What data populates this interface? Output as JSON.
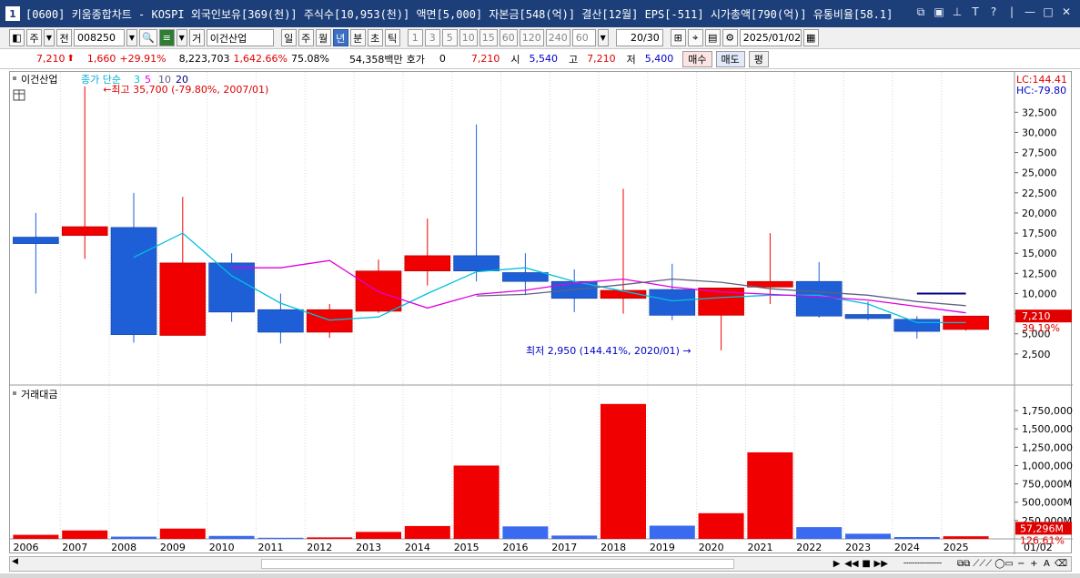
{
  "window": {
    "number": "1",
    "title": "[0600] 키움종합차트 - KOSPI 외국인보유[369(천)] 주식수[10,953(천)] 액면[5,000] 자본금[548(억)] 결산[12월] EPS[-511] 시가총액[790(억)] 유통비율[58.1]"
  },
  "toolbar": {
    "market": "주",
    "jeon": "전",
    "code": "008250",
    "gye": "거",
    "stock_name": "이건산업",
    "periods": [
      "일",
      "주",
      "월",
      "년",
      "분",
      "초",
      "틱"
    ],
    "intervals": [
      "1",
      "3",
      "5",
      "10",
      "15",
      "60",
      "120",
      "240"
    ],
    "interval_value": "60",
    "count": "20/30",
    "date": "2025/01/02"
  },
  "quote": {
    "price": "7,210",
    "change": "1,660",
    "change_pct": "+29.91%",
    "volume": "8,223,703",
    "volume_pct": "1,642.66%",
    "turnover_pct": "75.08%",
    "amount": "54,358백만",
    "hoga_label": "호가",
    "hoga_value": "0",
    "hoga_price": "7,210",
    "open_label": "시",
    "open": "5,540",
    "high_label": "고",
    "high": "7,210",
    "low_label": "저",
    "low": "5,400",
    "buy_label": "매수",
    "sell_label": "매도",
    "avg_label": "평"
  },
  "chart_data": {
    "type": "candlestick",
    "price_panel": {
      "name": "이건산업",
      "ma_legend_prefix": "종가 단순",
      "ma_periods": [
        "3",
        "5",
        "10",
        "20"
      ],
      "ma_colors": [
        "#00c0e0",
        "#e000e0",
        "#606080",
        "#000080"
      ],
      "lc_label": "LC:144.41",
      "hc_label": "HC:-79.80",
      "high_annotation": "최고 35,700 (-79.80%, 2007/01)",
      "low_annotation": "최저 2,950 (144.41%, 2020/01)",
      "current_price_label": "7,210",
      "current_pct_label": "39.19%",
      "y_ticks": [
        "2,500",
        "5,000",
        "7,500",
        "10,000",
        "12,500",
        "15,000",
        "17,500",
        "20,000",
        "22,500",
        "25,000",
        "27,500",
        "30,000",
        "32,500"
      ],
      "ylim": [
        0,
        35700
      ],
      "candles": [
        {
          "year": "2006",
          "open": 17000,
          "high": 20000,
          "low": 10000,
          "close": 16200
        },
        {
          "year": "2007",
          "open": 17200,
          "high": 35700,
          "low": 14300,
          "close": 18300
        },
        {
          "year": "2008",
          "open": 18200,
          "high": 22500,
          "low": 3900,
          "close": 4900
        },
        {
          "year": "2009",
          "open": 4800,
          "high": 22000,
          "low": 4800,
          "close": 13800
        },
        {
          "year": "2010",
          "open": 13800,
          "high": 15000,
          "low": 6500,
          "close": 7700
        },
        {
          "year": "2011",
          "open": 8000,
          "high": 10000,
          "low": 3800,
          "close": 5200
        },
        {
          "year": "2012",
          "open": 5200,
          "high": 8700,
          "low": 4500,
          "close": 8000
        },
        {
          "year": "2013",
          "open": 7800,
          "high": 14200,
          "low": 7600,
          "close": 12800
        },
        {
          "year": "2014",
          "open": 12800,
          "high": 19300,
          "low": 11000,
          "close": 14700
        },
        {
          "year": "2015",
          "open": 14700,
          "high": 31000,
          "low": 11500,
          "close": 12800
        },
        {
          "year": "2016",
          "open": 12600,
          "high": 15000,
          "low": 9800,
          "close": 11500
        },
        {
          "year": "2017",
          "open": 11500,
          "high": 13000,
          "low": 7700,
          "close": 9400
        },
        {
          "year": "2018",
          "open": 9400,
          "high": 23000,
          "low": 7500,
          "close": 10400
        },
        {
          "year": "2019",
          "open": 10500,
          "high": 13700,
          "low": 6700,
          "close": 7300
        },
        {
          "year": "2020",
          "open": 7300,
          "high": 10700,
          "low": 2950,
          "close": 10700
        },
        {
          "year": "2021",
          "open": 10800,
          "high": 17500,
          "low": 8700,
          "close": 11500
        },
        {
          "year": "2022",
          "open": 11500,
          "high": 13900,
          "low": 7000,
          "close": 7200
        },
        {
          "year": "2023",
          "open": 7400,
          "high": 9000,
          "low": 6700,
          "close": 6900
        },
        {
          "year": "2024",
          "open": 6800,
          "high": 7200,
          "low": 4400,
          "close": 5300
        },
        {
          "year": "2025",
          "open": 5540,
          "high": 7210,
          "low": 5400,
          "close": 7210
        }
      ],
      "ma_series": [
        {
          "period": "3",
          "values": [
            null,
            null,
            14500,
            17500,
            12200,
            8800,
            6700,
            7100,
            10000,
            12700,
            13200,
            11500,
            10300,
            9100,
            9500,
            9800,
            9800,
            8700,
            6400,
            6400
          ]
        },
        {
          "period": "5",
          "values": [
            null,
            null,
            null,
            null,
            13200,
            13200,
            14100,
            10200,
            8200,
            9900,
            10400,
            11300,
            11800,
            10800,
            10200,
            9900,
            9600,
            9200,
            8400,
            7600
          ]
        },
        {
          "period": "10",
          "values": [
            null,
            null,
            null,
            null,
            null,
            null,
            null,
            null,
            null,
            9700,
            9900,
            10500,
            11100,
            11800,
            11400,
            10600,
            10200,
            9800,
            9000,
            8500
          ]
        },
        {
          "period": "20",
          "values": [
            null,
            null,
            null,
            null,
            null,
            null,
            null,
            null,
            null,
            null,
            null,
            null,
            null,
            null,
            null,
            null,
            null,
            null,
            10000,
            10000
          ]
        }
      ]
    },
    "volume_panel": {
      "name": "거래대금",
      "y_ticks": [
        "250,000M",
        "500,000M",
        "750,000M",
        "1,000,000M",
        "1,250,000M",
        "1,500,000M",
        "1,750,000M"
      ],
      "ylim": [
        0,
        1850000
      ],
      "current_label": "57,296M",
      "current_pct_label": "126.61%",
      "values": [
        55000,
        115000,
        30000,
        140000,
        40000,
        15000,
        20000,
        95000,
        175000,
        1000000,
        170000,
        45000,
        1840000,
        180000,
        350000,
        1180000,
        160000,
        70000,
        25000,
        35000
      ],
      "colors": [
        "up",
        "up",
        "down",
        "up",
        "down",
        "down",
        "up",
        "up",
        "up",
        "up",
        "down",
        "down",
        "up",
        "down",
        "up",
        "up",
        "down",
        "down",
        "down",
        "up"
      ]
    },
    "x_labels": [
      "2006",
      "2007",
      "2008",
      "2009",
      "2010",
      "2011",
      "2012",
      "2013",
      "2014",
      "2015",
      "2016",
      "2017",
      "2018",
      "2019",
      "2020",
      "2021",
      "2022",
      "2023",
      "2024",
      "2025"
    ],
    "x_end_label": "01/02",
    "up_color": "#f00000",
    "down_color": "#1e5fd8"
  }
}
